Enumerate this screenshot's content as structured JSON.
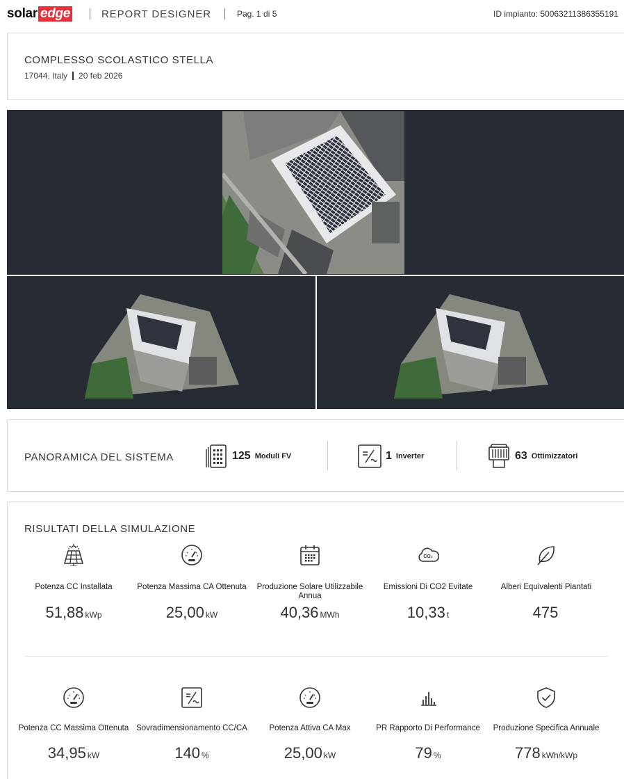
{
  "header": {
    "logo_solar": "solar",
    "logo_edge": "edge",
    "app_title": "REPORT DESIGNER",
    "page_info": "Pag. 1 di 5",
    "plant_id": "ID impianto: 50063211386355191"
  },
  "project": {
    "name": "COMPLESSO SCOLASTICO STELLA",
    "location": "17044, Italy",
    "date": "20 feb 2026"
  },
  "overview": {
    "title": "PANORAMICA DEL SISTEMA",
    "items": [
      {
        "icon": "pv-module-icon",
        "count": "125",
        "label": "Moduli FV"
      },
      {
        "icon": "inverter-icon",
        "count": "1",
        "label": "Inverter"
      },
      {
        "icon": "optimizer-icon",
        "count": "63",
        "label": "Ottimizzatori"
      }
    ]
  },
  "results": {
    "title": "RISULTATI DELLA SIMULAZIONE",
    "row1": [
      {
        "icon": "solar-panel-icon",
        "label": "Potenza CC Installata",
        "value": "51,88",
        "unit": "kWp"
      },
      {
        "icon": "gauge-icon",
        "label": "Potenza Massima CA Ottenuta",
        "value": "25,00",
        "unit": "kW"
      },
      {
        "icon": "calendar-icon",
        "label": "Produzione Solare Utilizzabile Annua",
        "value": "40,36",
        "unit": "MWh"
      },
      {
        "icon": "co2-cloud-icon",
        "label": "Emissioni Di CO2 Evitate",
        "value": "10,33",
        "unit": "t"
      },
      {
        "icon": "leaf-icon",
        "label": "Alberi Equivalenti Piantati",
        "value": "475",
        "unit": ""
      }
    ],
    "row2": [
      {
        "icon": "gauge-icon",
        "label": "Potenza CC Massima Ottenuta",
        "value": "34,95",
        "unit": "kW"
      },
      {
        "icon": "dc-ac-ratio-icon",
        "label": "Sovradimensionamento CC/CA",
        "value": "140",
        "unit": "%"
      },
      {
        "icon": "gauge-icon",
        "label": "Potenza Attiva CA Max",
        "value": "25,00",
        "unit": "kW"
      },
      {
        "icon": "bar-chart-icon",
        "label": "PR Rapporto Di Performance",
        "value": "79",
        "unit": "%"
      },
      {
        "icon": "shield-check-icon",
        "label": "Produzione Specifica Annuale",
        "value": "778",
        "unit": "kWh/kWp"
      }
    ]
  },
  "colors": {
    "brand_red": "#e8303a",
    "image_background": "#272b34",
    "icon_stroke": "#333333"
  }
}
